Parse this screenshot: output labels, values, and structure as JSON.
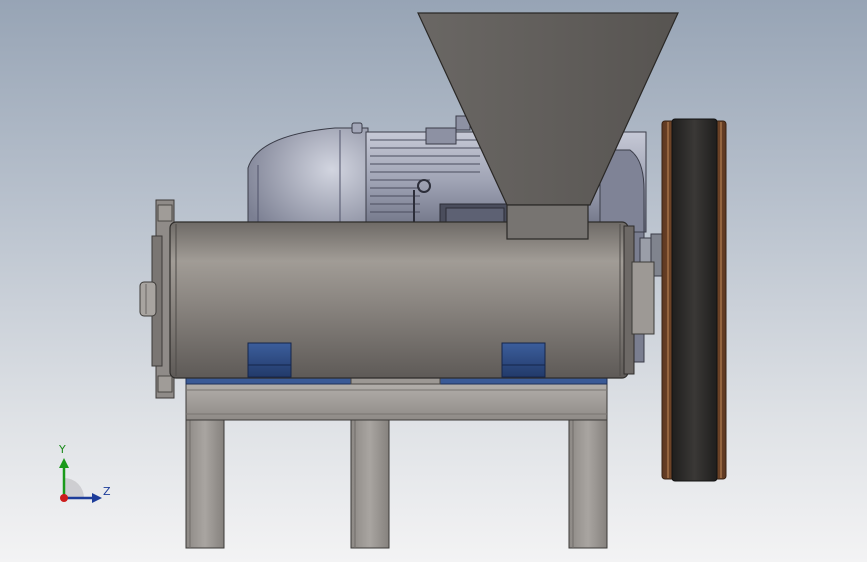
{
  "viewport": {
    "background_top": "#97a4b5",
    "background_bottom": "#f3f3f4"
  },
  "model": {
    "parts": [
      "hopper",
      "motor",
      "screw-barrel",
      "pulley",
      "base-frame",
      "mounting-blocks",
      "end-flange"
    ],
    "colors": {
      "hopper": "#646260",
      "motor": "#a9adbd",
      "barrel": "#8a8580",
      "frame": "#a29e99",
      "mount_blocks": "#2e4d88",
      "pulley_rim": "#7a4a2a",
      "pulley_belt": "#2b2a29"
    }
  },
  "triad": {
    "y_label": "Y",
    "z_label": "Z",
    "y_color": "#1a9a1a",
    "z_color": "#1d3c9a",
    "x_color": "#cc1c1c"
  }
}
